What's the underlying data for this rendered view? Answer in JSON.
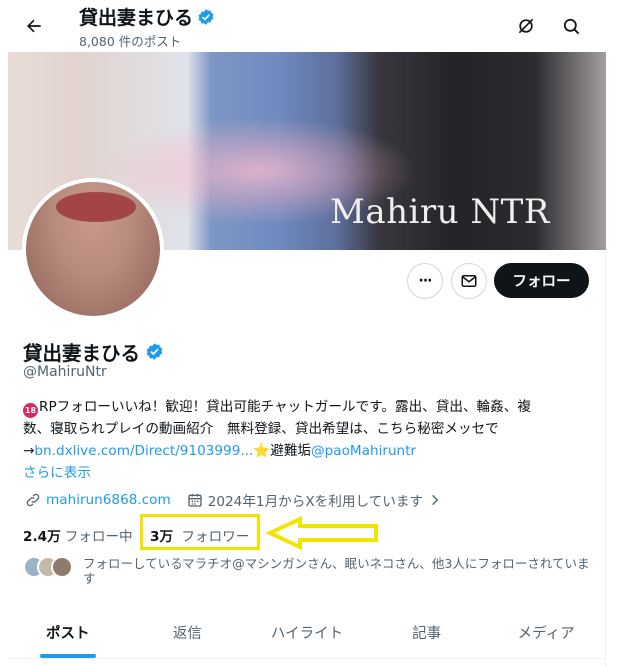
{
  "header": {
    "name": "貸出妻まひる",
    "post_count": "8,080 件のポスト"
  },
  "banner": {
    "text": "Mahiru NTR"
  },
  "actions": {
    "more_label": "···",
    "follow_label": "フォロー"
  },
  "profile": {
    "name": "貸出妻まひる",
    "handle": "@MahiruNtr",
    "bio_line1_badge": "18",
    "bio_line1": "RPフォローいいね！歓迎！貸出可能チャットガールです。露出、貸出、輪姦、複",
    "bio_line2": "数、寝取られプレイの動画紹介　無料登録、貸出希望は、こちら秘密メッセで",
    "bio_line3_prefix": "→",
    "bio_link": "bn.dxlive.com/Direct/9103999...",
    "bio_star": "⭐",
    "bio_refuge": "避難垢",
    "bio_mention": "@paoMahiruntr",
    "show_more": "さらに表示",
    "website": "mahirun6868.com",
    "joined": "2024年1月からXを利用しています",
    "following_count": "2.4万",
    "following_label": "フォロー中",
    "followers_count": "3万",
    "followers_label": "フォロワー",
    "followed_by": "フォローしているマラチオ@マシンガンさん、眠いネコさん、他3人にフォローされています"
  },
  "tabs": [
    {
      "label": "ポスト"
    },
    {
      "label": "返信"
    },
    {
      "label": "ハイライト"
    },
    {
      "label": "記事"
    },
    {
      "label": "メディア"
    }
  ],
  "colors": {
    "accent": "#1d9bf0",
    "highlight": "#f3e400",
    "text": "#0f1419",
    "muted": "#536471"
  },
  "icons": {
    "back": "arrow-left-icon",
    "grok": "grok-icon",
    "search": "search-icon",
    "verified": "verified-badge-icon",
    "mail": "mail-icon",
    "link": "link-icon",
    "calendar": "calendar-icon",
    "chevron": "chevron-right-icon"
  }
}
